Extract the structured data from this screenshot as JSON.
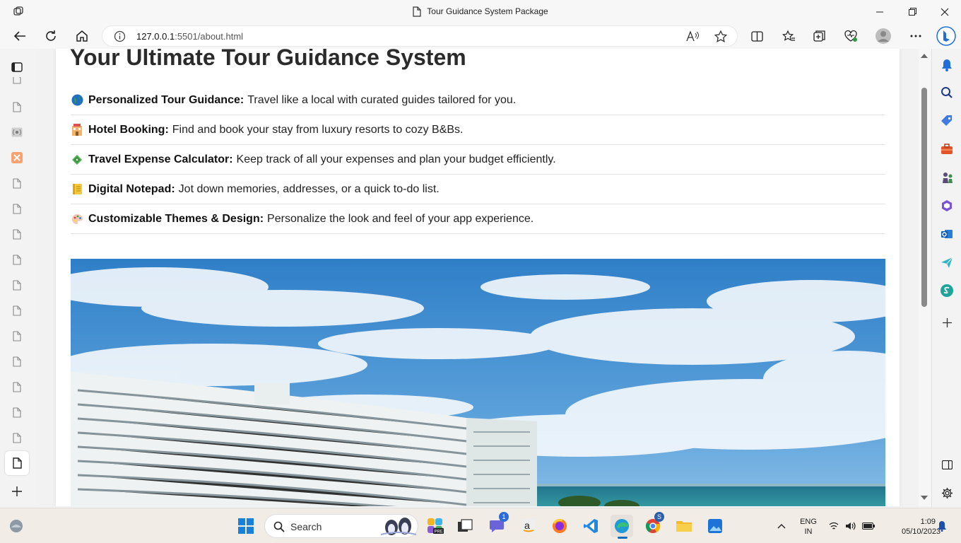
{
  "window": {
    "title": "Tour Guidance System Package"
  },
  "address_bar": {
    "host": "127.0.0.1",
    "rest": ":5501/about.html"
  },
  "page": {
    "headline": "Your Ultimate Tour Guidance System",
    "features": [
      {
        "icon": "globe-icon",
        "title": "Personalized Tour Guidance:",
        "text": "Travel like a local with curated guides tailored for you."
      },
      {
        "icon": "hotel-icon",
        "title": "Hotel Booking:",
        "text": "Find and book your stay from luxury resorts to cozy B&Bs."
      },
      {
        "icon": "money-icon",
        "title": "Travel Expense Calculator:",
        "text": "Keep track of all your expenses and plan your budget efficiently."
      },
      {
        "icon": "notepad-icon",
        "title": "Digital Notepad:",
        "text": "Jot down memories, addresses, or a quick to-do list."
      },
      {
        "icon": "palette-icon",
        "title": "Customizable Themes & Design:",
        "text": "Personalize the look and feel of your app experience."
      }
    ]
  },
  "taskbar": {
    "search_label": "Search",
    "chat_badge": "1",
    "chrome_badge": "S",
    "lang_line1": "ENG",
    "lang_line2": "IN",
    "time": "1:09",
    "date": "05/10/2023"
  },
  "colors": {
    "accent": "#0f6cbd",
    "sky": "#4a90d0",
    "sea": "#2a8c9a"
  }
}
